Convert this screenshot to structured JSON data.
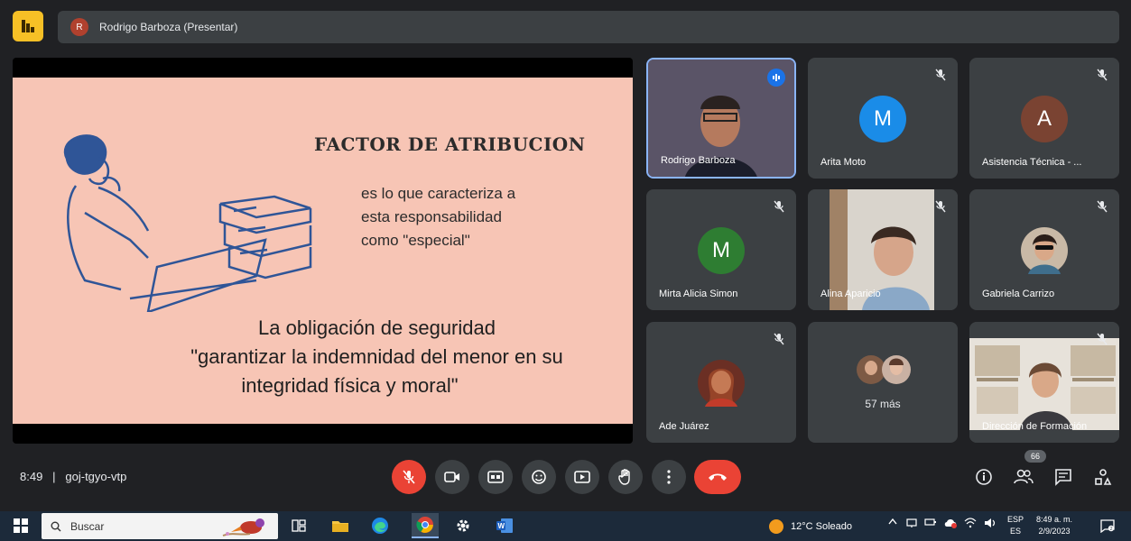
{
  "presenter": {
    "initial": "R",
    "label": "Rodrigo Barboza (Presentar)"
  },
  "slide": {
    "title": "FACTOR DE ATRIBUCION",
    "desc_lines": [
      "es lo que caracteriza a",
      "esta responsabilidad",
      "como \"especial\""
    ],
    "obligation_lines": [
      "La obligación de seguridad",
      "\"garantizar la indemnidad del menor en su",
      "integridad física y moral\""
    ]
  },
  "participants": [
    {
      "name": "Rodrigo Barboza",
      "type": "video",
      "speaking": true
    },
    {
      "name": "Arita Moto",
      "type": "avatar",
      "initial": "M",
      "color": "#1a8ce8"
    },
    {
      "name": "Asistencia Técnica - ...",
      "type": "avatar",
      "initial": "A",
      "color": "#7a4332"
    },
    {
      "name": "Mirta Alicia Simon",
      "type": "avatar",
      "initial": "M",
      "color": "#2e7d32"
    },
    {
      "name": "Alina Aparicio",
      "type": "video"
    },
    {
      "name": "Gabriela Carrizo",
      "type": "photo"
    },
    {
      "name": "Ade Juárez",
      "type": "photo"
    },
    {
      "name": "57 más",
      "type": "group"
    },
    {
      "name": "Dirección de Formación",
      "type": "video"
    }
  ],
  "meeting": {
    "time": "8:49",
    "separator": "|",
    "code": "goj-tgyo-vtp",
    "participant_count": "66"
  },
  "taskbar": {
    "search_placeholder": "Buscar",
    "weather": "12°C  Soleado",
    "lang_1": "ESP",
    "lang_2": "ES",
    "clock_time": "8:49 a. m.",
    "clock_date": "2/9/2023"
  },
  "colors": {
    "background": "#202124",
    "tile": "#3c4043",
    "danger": "#ea4335",
    "slide_bg": "#f7c5b5",
    "accent": "#8ab4f8"
  }
}
